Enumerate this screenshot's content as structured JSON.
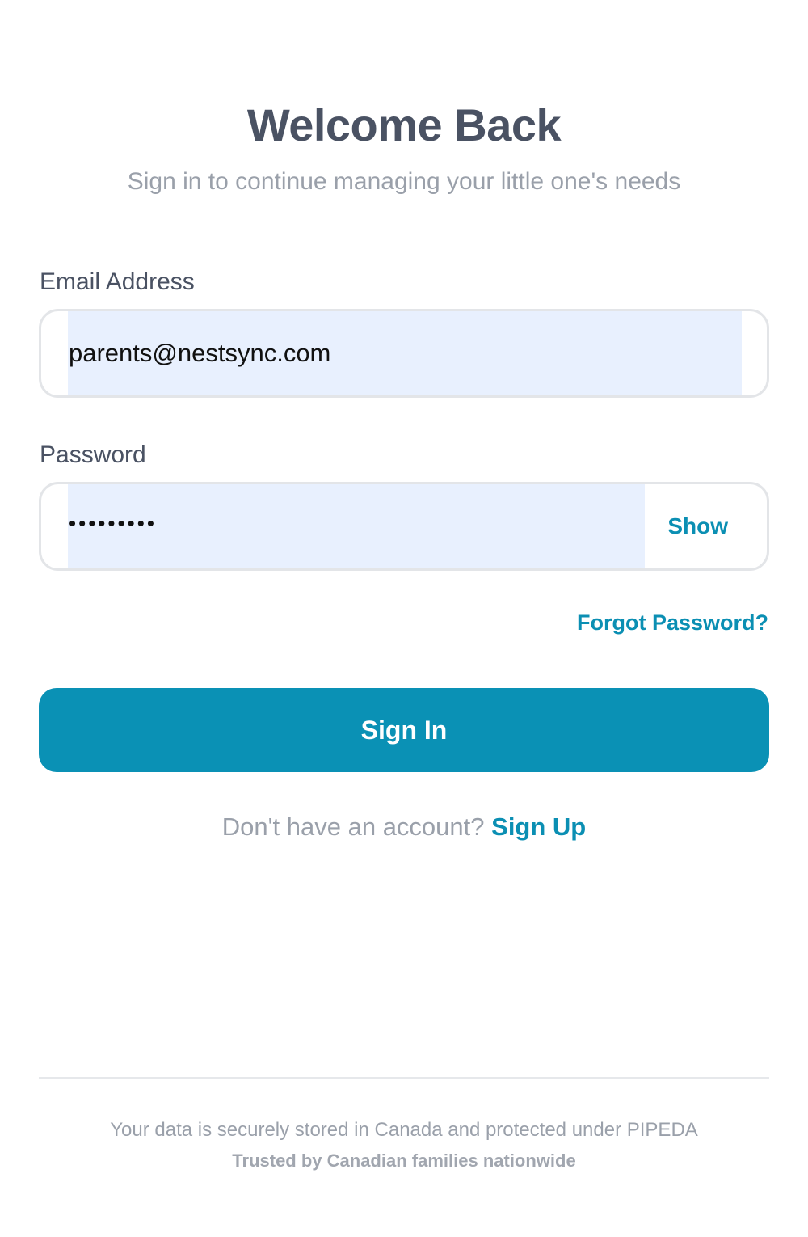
{
  "header": {
    "title": "Welcome Back",
    "subtitle": "Sign in to continue managing your little one's needs"
  },
  "form": {
    "email": {
      "label": "Email Address",
      "value": "parents@nestsync.com"
    },
    "password": {
      "label": "Password",
      "value": "•••••••••",
      "toggle_label": "Show"
    },
    "forgot_label": "Forgot Password?",
    "submit_label": "Sign In"
  },
  "signup": {
    "prompt": "Don't have an account?",
    "link_label": "Sign Up"
  },
  "footer": {
    "privacy_note": "Your data is securely stored in Canada and protected under PIPEDA",
    "trust_note": "Trusted by Canadian families nationwide"
  },
  "colors": {
    "accent": "#0a91b5",
    "heading": "#4a5263",
    "muted": "#9aa0aa",
    "autofill": "#e8f0fe"
  }
}
